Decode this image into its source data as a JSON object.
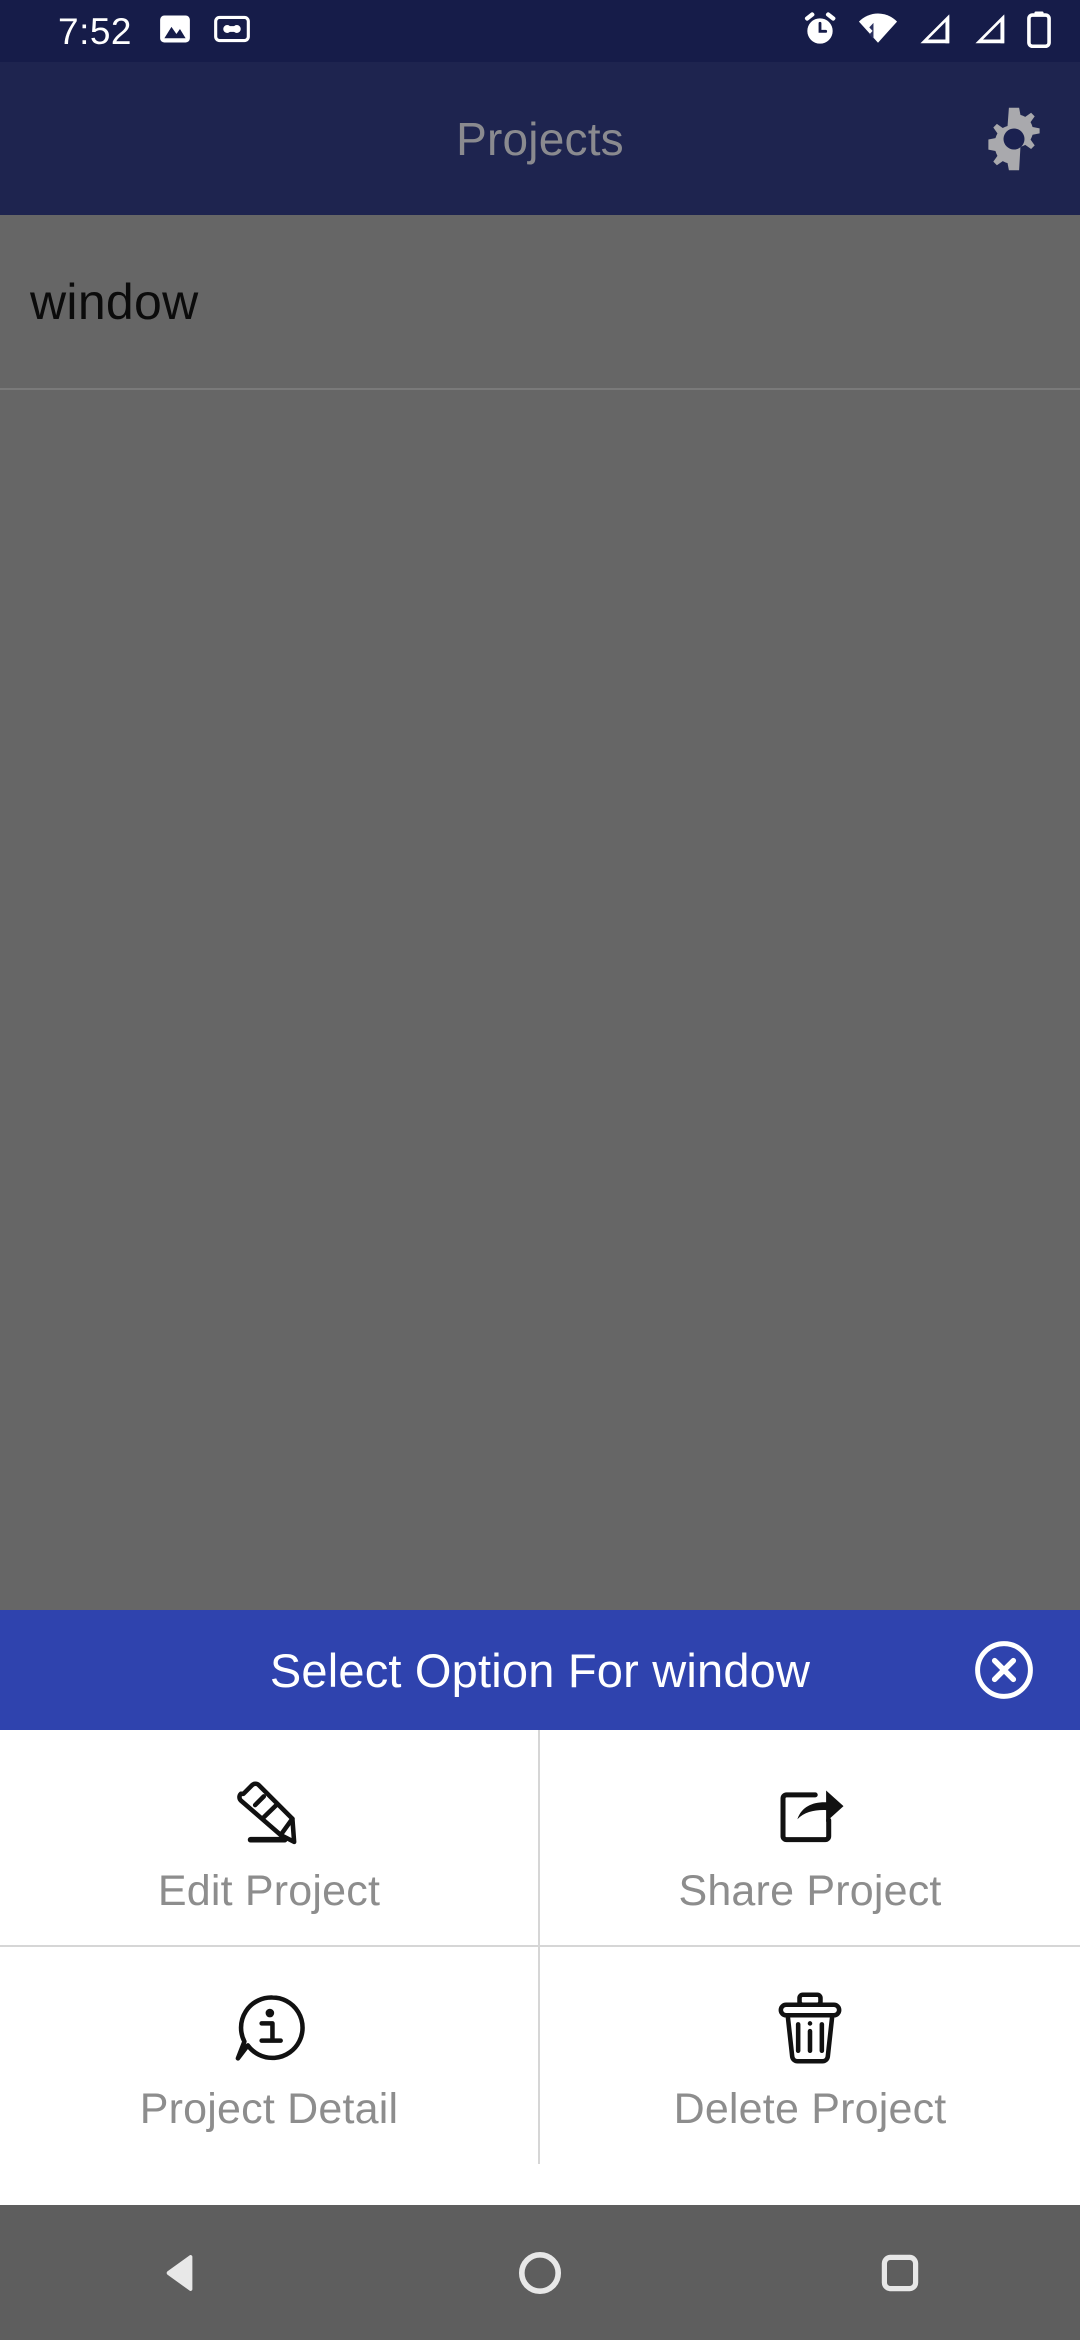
{
  "status_bar": {
    "time": "7:52",
    "left_icons": [
      {
        "name": "image-icon"
      },
      {
        "name": "cassette-icon"
      }
    ],
    "right_icons": [
      {
        "name": "alarm-icon"
      },
      {
        "name": "wifi-icon"
      },
      {
        "name": "signal-1-icon"
      },
      {
        "name": "signal-2-icon"
      },
      {
        "name": "battery-icon"
      }
    ]
  },
  "app_bar": {
    "title": "Projects",
    "settings_icon": "gear-icon",
    "background_color": "#161C49",
    "title_color": "#8a8a8f"
  },
  "content": {
    "scrim_color": "#666666",
    "items": [
      {
        "label": "window"
      }
    ]
  },
  "sheet": {
    "title": "Select Option For window",
    "header_color": "#2F43AE",
    "close_icon": "close-circle-icon",
    "options": [
      {
        "label": "Edit Project",
        "icon": "pencil-icon"
      },
      {
        "label": "Share Project",
        "icon": "share-icon"
      },
      {
        "label": "Project Detail",
        "icon": "info-bubble-icon"
      },
      {
        "label": "Delete Project",
        "icon": "trash-icon"
      }
    ],
    "label_color": "#8d8d8d"
  },
  "nav_bar": {
    "background_color": "#5e5e5e",
    "buttons": [
      {
        "name": "back-button",
        "icon": "triangle-back-icon"
      },
      {
        "name": "home-button",
        "icon": "circle-home-icon"
      },
      {
        "name": "recents-button",
        "icon": "square-recents-icon"
      }
    ]
  }
}
